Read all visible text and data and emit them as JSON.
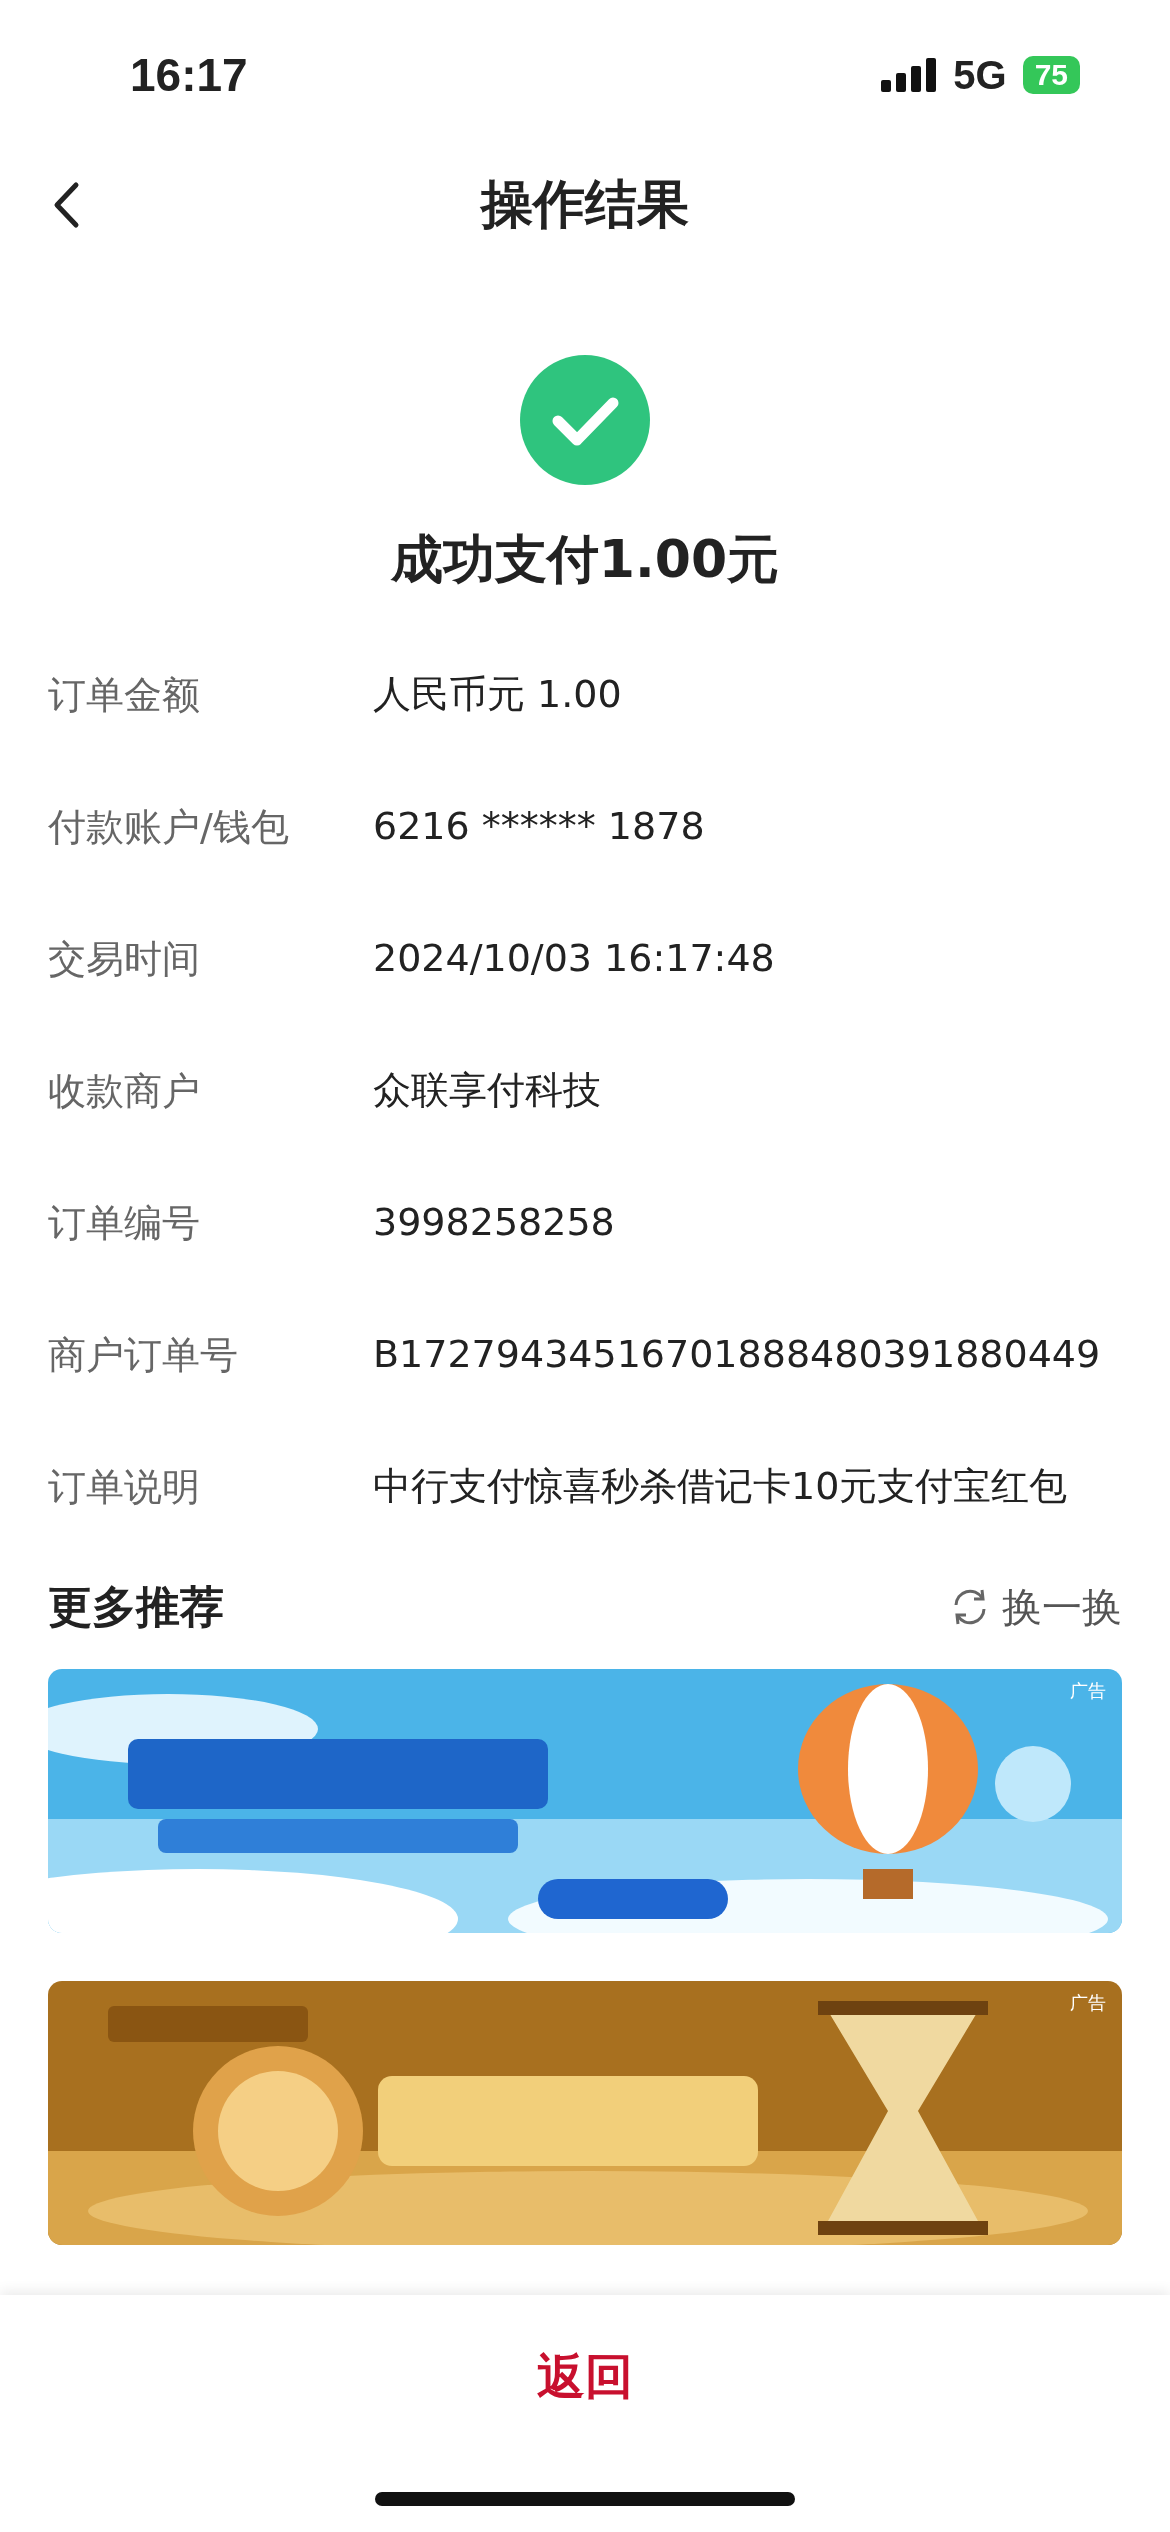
{
  "status_bar": {
    "time": "16:17",
    "network": "5G",
    "battery": "75"
  },
  "header": {
    "title": "操作结果"
  },
  "result": {
    "message": "成功支付1.00元"
  },
  "details": [
    {
      "label": "订单金额",
      "value": "人民币元 1.00"
    },
    {
      "label": "付款账户/钱包",
      "value": "6216 ****** 1878"
    },
    {
      "label": "交易时间",
      "value": "2024/10/03 16:17:48"
    },
    {
      "label": "收款商户",
      "value": "众联享付科技"
    },
    {
      "label": "订单编号",
      "value": "3998258258"
    },
    {
      "label": "商户订单号",
      "value": "B17279434516701888480391880449"
    },
    {
      "label": "订单说明",
      "value": "中行支付惊喜秒杀借记卡10元支付宝红包"
    }
  ],
  "recommend": {
    "title": "更多推荐",
    "refresh": "换一换",
    "banners": [
      {
        "kind": "sky",
        "tag": "广告"
      },
      {
        "kind": "gold",
        "tag": "广告"
      }
    ]
  },
  "footer": {
    "button": "返回"
  }
}
